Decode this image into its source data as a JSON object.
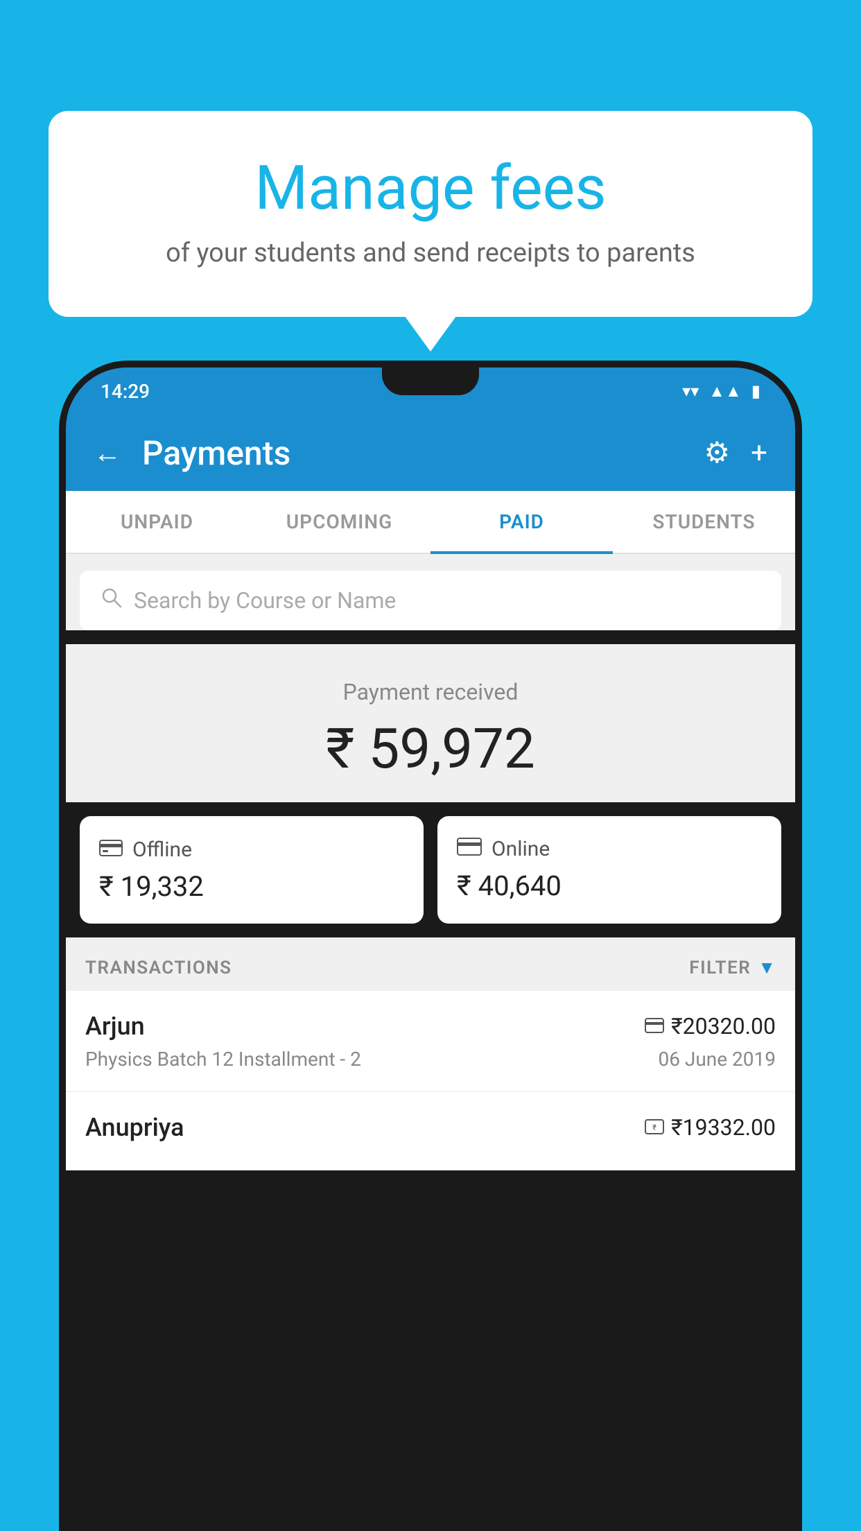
{
  "background_color": "#18b4e8",
  "speech_bubble": {
    "title": "Manage fees",
    "subtitle": "of your students and send receipts to parents"
  },
  "status_bar": {
    "time": "14:29",
    "wifi": "▼",
    "signal": "▲",
    "battery": "▮"
  },
  "app_bar": {
    "title": "Payments",
    "back_label": "←",
    "gear_label": "⚙",
    "plus_label": "+"
  },
  "tabs": [
    {
      "label": "UNPAID",
      "active": false
    },
    {
      "label": "UPCOMING",
      "active": false
    },
    {
      "label": "PAID",
      "active": true
    },
    {
      "label": "STUDENTS",
      "active": false
    }
  ],
  "search": {
    "placeholder": "Search by Course or Name"
  },
  "payment_received": {
    "label": "Payment received",
    "amount": "₹ 59,972"
  },
  "payment_cards": [
    {
      "icon": "offline",
      "label": "Offline",
      "amount": "₹ 19,332"
    },
    {
      "icon": "online",
      "label": "Online",
      "amount": "₹ 40,640"
    }
  ],
  "transactions_section": {
    "label": "TRANSACTIONS",
    "filter_label": "FILTER"
  },
  "transactions": [
    {
      "name": "Arjun",
      "type_icon": "card",
      "amount": "₹20320.00",
      "detail": "Physics Batch 12 Installment - 2",
      "date": "06 June 2019"
    },
    {
      "name": "Anupriya",
      "type_icon": "cash",
      "amount": "₹19332.00",
      "detail": "",
      "date": ""
    }
  ]
}
